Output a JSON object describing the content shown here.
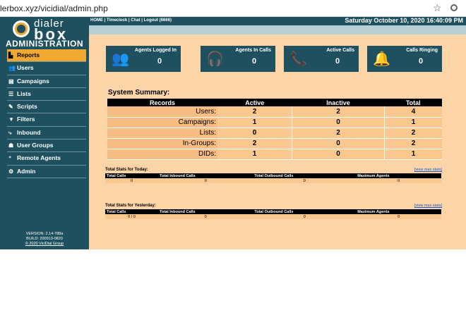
{
  "browser": {
    "url": "lerbox.xyz/vicidial/admin.php"
  },
  "logo": {
    "word1": "dialer",
    "word2": "box",
    "admin": "ADMINISTRATION"
  },
  "nav": [
    {
      "label": "Reports",
      "icon": "report-icon",
      "glyph": "▙",
      "active": true
    },
    {
      "label": "Users",
      "icon": "users-icon",
      "glyph": "👥",
      "active": false
    },
    {
      "label": "Campaigns",
      "icon": "campaigns-icon",
      "glyph": "▤",
      "active": false
    },
    {
      "label": "Lists",
      "icon": "lists-icon",
      "glyph": "☰",
      "active": false
    },
    {
      "label": "Scripts",
      "icon": "scripts-icon",
      "glyph": "✎",
      "active": false
    },
    {
      "label": "Filters",
      "icon": "filter-icon",
      "glyph": "▼",
      "active": false
    },
    {
      "label": "Inbound",
      "icon": "inbound-icon",
      "glyph": "⤷",
      "active": false
    },
    {
      "label": "User Groups",
      "icon": "user-groups-icon",
      "glyph": "☗",
      "active": false
    },
    {
      "label": "Remote Agents",
      "icon": "remote-agents-icon",
      "glyph": "⁺",
      "active": false
    },
    {
      "label": "Admin",
      "icon": "gear-icon",
      "glyph": "⚙",
      "active": false
    }
  ],
  "version": {
    "line1": "VERSION: 2.14-788a",
    "line2": "BUILD: 200913-0820",
    "line3": "© 2020 ViciDial Group"
  },
  "topbar": {
    "links": "HOME | Timeclock | Chat | Logout (6666)",
    "datetime": "Saturday October 10, 2020 16:40:09 PM"
  },
  "stats": [
    {
      "label": "Agents Logged In",
      "value": "0",
      "icon": "agents-group-icon",
      "glyph": "👥"
    },
    {
      "label": "Agents In Calls",
      "value": "0",
      "icon": "agents-headset-icon",
      "glyph": "🎧"
    },
    {
      "label": "Active Calls",
      "value": "0",
      "icon": "phone-icon",
      "glyph": "📞"
    },
    {
      "label": "Calls Ringing",
      "value": "0",
      "icon": "bell-ringing-icon",
      "glyph": "🔔"
    }
  ],
  "summary": {
    "title": "System Summary:",
    "headers": [
      "Records",
      "Active",
      "Inactive",
      "Total"
    ],
    "rows": [
      {
        "label": "Users:",
        "active": "2",
        "inactive": "2",
        "total": "4"
      },
      {
        "label": "Campaigns:",
        "active": "1",
        "inactive": "0",
        "total": "1"
      },
      {
        "label": "Lists:",
        "active": "0",
        "inactive": "2",
        "total": "2"
      },
      {
        "label": "In-Groups:",
        "active": "2",
        "inactive": "0",
        "total": "2"
      },
      {
        "label": "DIDs:",
        "active": "1",
        "inactive": "0",
        "total": "1"
      }
    ]
  },
  "today": {
    "title": "Total Stats for Today:",
    "view_max": "[view max stats]",
    "headers": [
      "Total Calls",
      "Total Inbound Calls",
      "Total Outbound Calls",
      "Maximum Agents"
    ],
    "values": [
      "0",
      "0",
      "0",
      "0"
    ]
  },
  "yesterday": {
    "title": "Total Stats for Yesterday:",
    "view_max": "[view max stats]",
    "headers": [
      "Total Calls",
      "Total Inbound Calls",
      "Total Outbound Calls",
      "Maximum Agents"
    ],
    "values": [
      "0 / 0",
      "0",
      "0",
      "0"
    ]
  }
}
